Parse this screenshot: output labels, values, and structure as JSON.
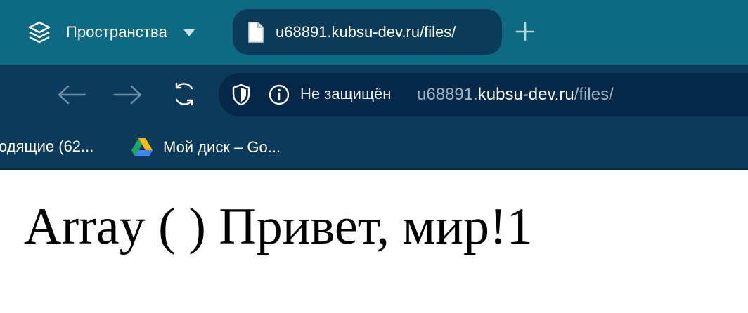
{
  "tabbar": {
    "spaces_label": "Пространства",
    "tab_title": "u68891.kubsu-dev.ru/files/",
    "icons": [
      "layers-icon",
      "chevron-down-icon",
      "file-icon",
      "plus-icon"
    ]
  },
  "toolbar": {
    "icons": [
      "back-arrow-icon",
      "forward-arrow-icon",
      "refresh-icon",
      "shield-icon",
      "info-icon"
    ],
    "security_text": "Не защищён",
    "url": {
      "prefix": "u68891.",
      "domain": "kubsu-dev.ru",
      "path": "/files/"
    }
  },
  "bookmarks": {
    "items": [
      {
        "label": "одящие (62..."
      },
      {
        "label": "Мой диск – Go...",
        "icon": "google-drive-icon"
      }
    ]
  },
  "page": {
    "body_text": "Array ( ) Привет, мир!1"
  },
  "colors": {
    "tabbar_bg": "#0e6a82",
    "active_tab_bg": "#0a3c5a",
    "toolbar_bg": "#0b3a5c",
    "omnibox_bg": "#062848"
  }
}
